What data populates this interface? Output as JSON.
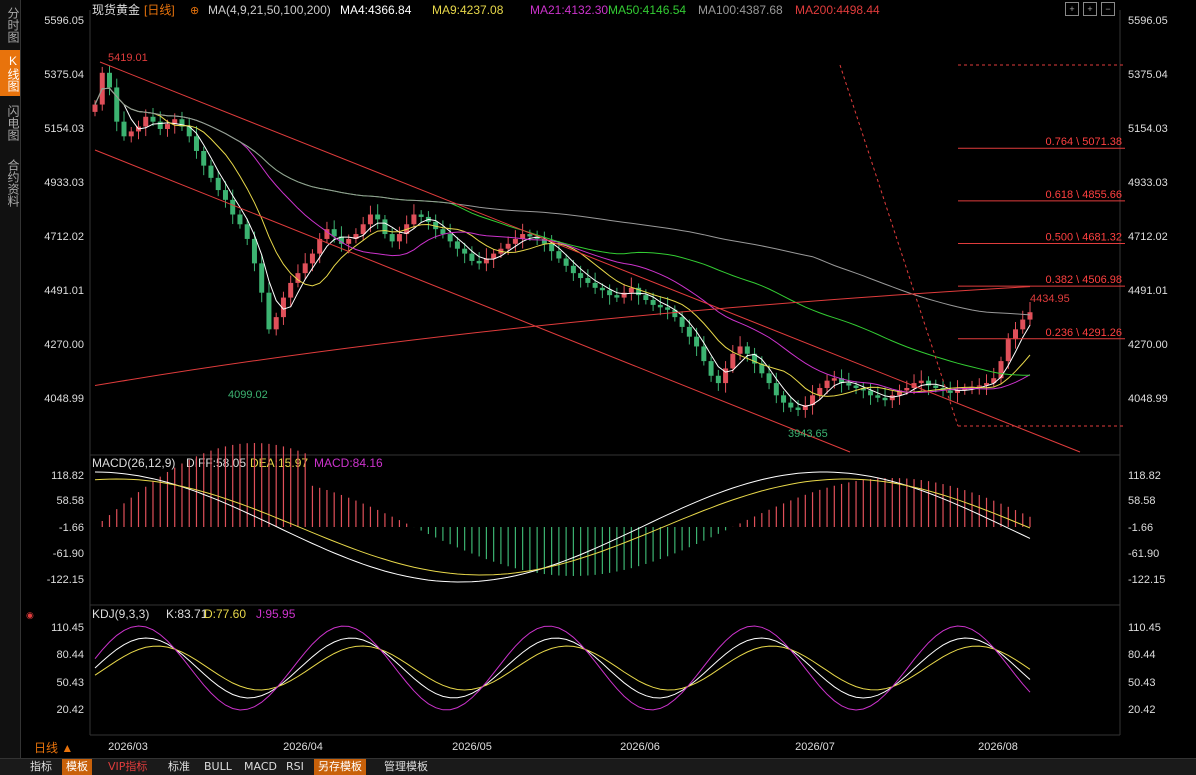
{
  "sidebar": {
    "tabs": [
      {
        "label": "分时图",
        "active": false
      },
      {
        "label": "K线图",
        "active": true
      },
      {
        "label": "闪电图",
        "active": false
      },
      {
        "label": "合约资料",
        "active": false
      }
    ]
  },
  "header": {
    "symbol": "现货黄金",
    "period": "[日线]",
    "ma_label": "MA(4,9,21,50,100,200)",
    "ma": [
      {
        "label": "MA4:4366.84",
        "color": "#ffffff"
      },
      {
        "label": "MA9:4237.08",
        "color": "#e8d84a"
      },
      {
        "label": "MA21:4132.30",
        "color": "#cc33cc"
      },
      {
        "label": "MA50:4146.54",
        "color": "#33cc33"
      },
      {
        "label": "MA100:4387.68",
        "color": "#999999"
      },
      {
        "label": "MA200:4498.44",
        "color": "#e03c3c"
      }
    ]
  },
  "macd_header": {
    "title": "MACD(26,12,9)",
    "diff": "DIFF:58.05",
    "dea": "DEA:15.97",
    "macd": "MACD:84.16"
  },
  "kdj_header": {
    "title": "KDJ(9,3,3)",
    "k": "K:83.71",
    "d": "D:77.60",
    "j": "J:95.95"
  },
  "period_selector": "日线 ▲",
  "bottom_tabs": [
    "指标",
    "模板",
    "VIP指标",
    "标准",
    "BULL",
    "MACD",
    "RSI",
    "另存模板",
    "管理模板"
  ],
  "chart_data": {
    "type": "candlestick",
    "price_axis": {
      "ticks": [
        "5596.05",
        "5375.04",
        "5154.03",
        "4933.03",
        "4712.02",
        "4491.01",
        "4270.00",
        "4048.99"
      ],
      "range": [
        3880,
        5596.05
      ]
    },
    "macd_axis": {
      "ticks": [
        "118.82",
        "58.58",
        "-1.66",
        "-61.90",
        "-122.15"
      ]
    },
    "kdj_axis": {
      "ticks": [
        "110.45",
        "80.44",
        "50.43",
        "20.42"
      ]
    },
    "x_axis_labels": [
      "2026/03",
      "2026/04",
      "2026/05",
      "2026/06",
      "2026/07",
      "2026/08"
    ],
    "annotations": {
      "high": "5419.01",
      "low1": "4099.02",
      "low2": "3943.65",
      "last_high": "4434.95"
    },
    "fibonacci": [
      {
        "label": "0.764 \\ 5071.38",
        "price": 5071.38
      },
      {
        "label": "0.618 \\ 4855.66",
        "price": 4855.66
      },
      {
        "label": "0.500 \\ 4681.32",
        "price": 4681.32
      },
      {
        "label": "0.382 \\ 4506.98",
        "price": 4506.98
      },
      {
        "label": "0.236 \\ 4291.26",
        "price": 4291.26
      }
    ],
    "closes": [
      5250,
      5380,
      5320,
      5180,
      5120,
      5140,
      5160,
      5200,
      5180,
      5150,
      5170,
      5190,
      5160,
      5120,
      5060,
      5000,
      4950,
      4900,
      4860,
      4800,
      4760,
      4700,
      4600,
      4480,
      4330,
      4380,
      4460,
      4520,
      4560,
      4600,
      4640,
      4700,
      4740,
      4710,
      4680,
      4700,
      4720,
      4760,
      4800,
      4780,
      4720,
      4690,
      4720,
      4760,
      4800,
      4790,
      4770,
      4740,
      4720,
      4690,
      4660,
      4640,
      4610,
      4600,
      4620,
      4640,
      4660,
      4680,
      4700,
      4720,
      4710,
      4700,
      4680,
      4650,
      4620,
      4590,
      4560,
      4540,
      4520,
      4500,
      4490,
      4470,
      4460,
      4480,
      4500,
      4470,
      4450,
      4430,
      4420,
      4410,
      4380,
      4340,
      4300,
      4260,
      4200,
      4140,
      4110,
      4170,
      4230,
      4260,
      4230,
      4190,
      4150,
      4110,
      4060,
      4030,
      4010,
      4000,
      4020,
      4060,
      4090,
      4120,
      4130,
      4110,
      4100,
      4090,
      4080,
      4060,
      4050,
      4040,
      4060,
      4080,
      4090,
      4110,
      4120,
      4100,
      4090,
      4080,
      4070,
      4080,
      4090,
      4095,
      4100,
      4110,
      4130,
      4200,
      4290,
      4330,
      4370,
      4400
    ]
  }
}
